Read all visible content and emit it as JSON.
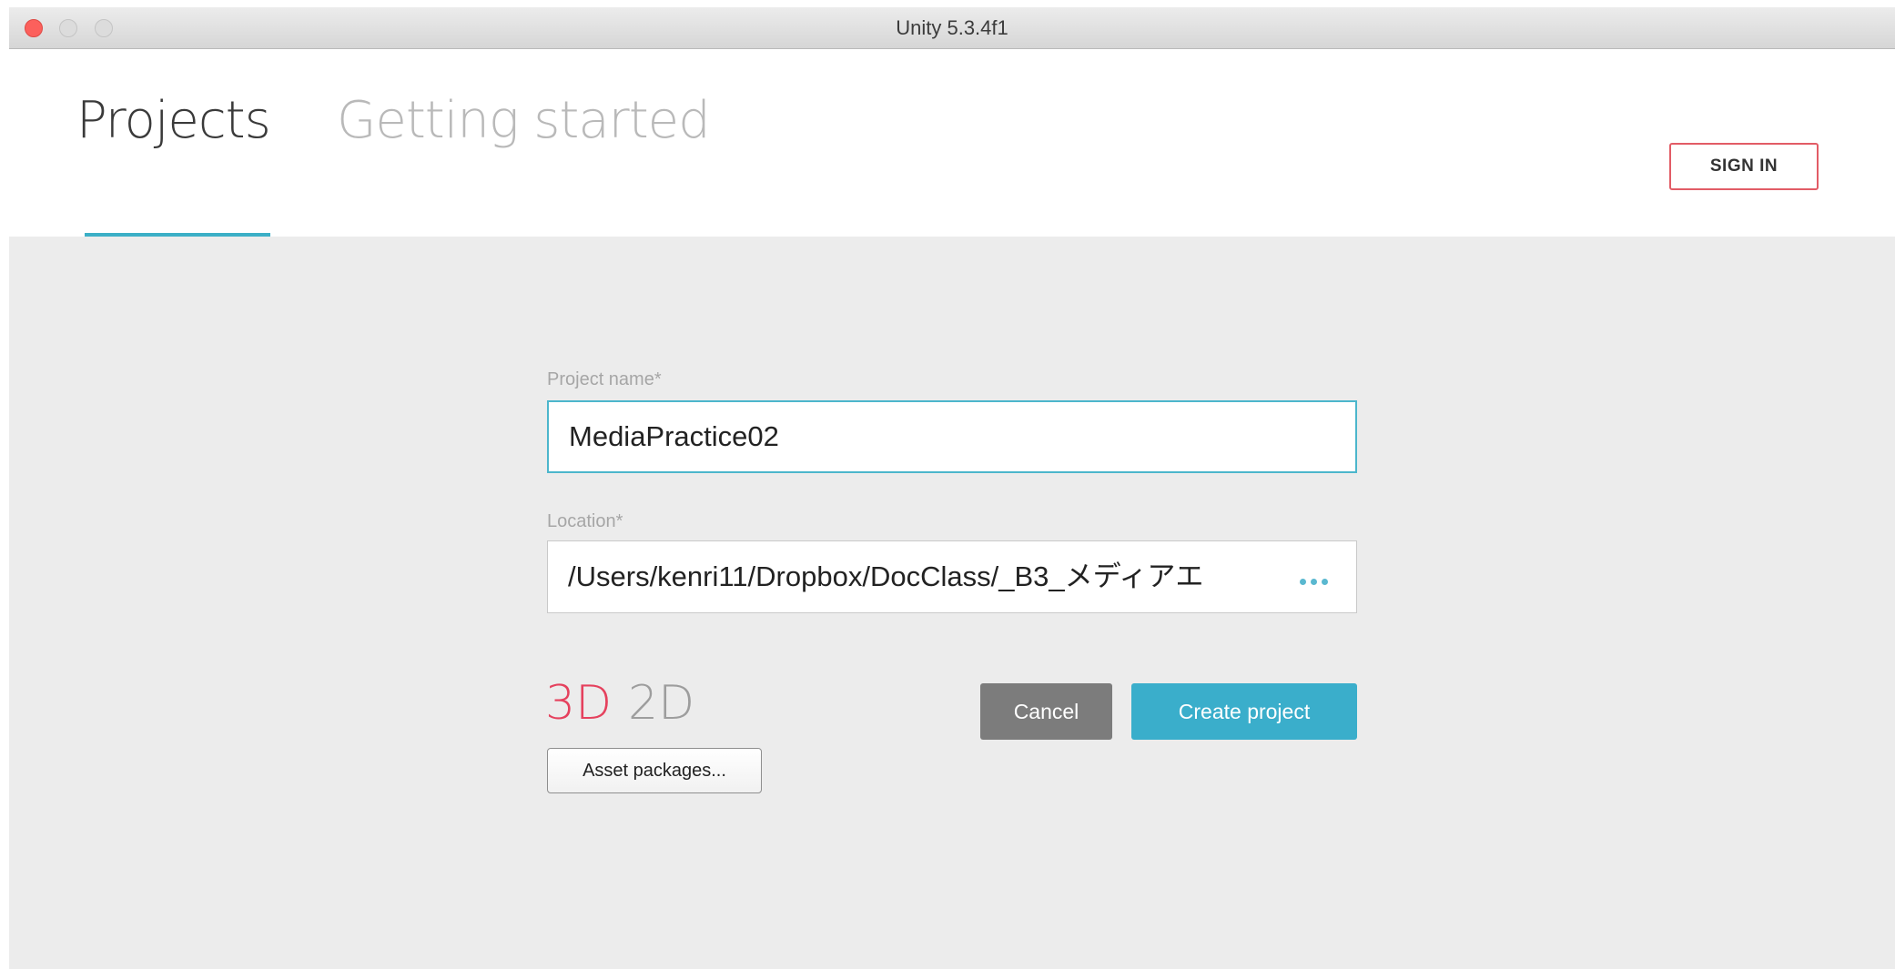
{
  "window": {
    "title": "Unity 5.3.4f1"
  },
  "tabs": [
    {
      "label": "Projects",
      "active": true
    },
    {
      "label": "Getting started",
      "active": false
    }
  ],
  "header": {
    "sign_in_label": "SIGN IN"
  },
  "form": {
    "project_name_label": "Project name*",
    "project_name_value": "MediaPractice02",
    "location_label": "Location*",
    "location_value": "/Users/kenri11/Dropbox/DocClass/_B3_メディアエ",
    "browse_icon": "ellipsis-icon",
    "mode_3d_label": "3D",
    "mode_2d_label": "2D",
    "selected_mode": "3D",
    "asset_packages_label": "Asset packages...",
    "cancel_label": "Cancel",
    "create_label": "Create project"
  },
  "colors": {
    "accent": "#3bafc6",
    "sign_in_border": "#e25c66",
    "mode_selected": "#e5415d",
    "cancel_bg": "#7c7c7c",
    "create_bg": "#3aaecb"
  }
}
